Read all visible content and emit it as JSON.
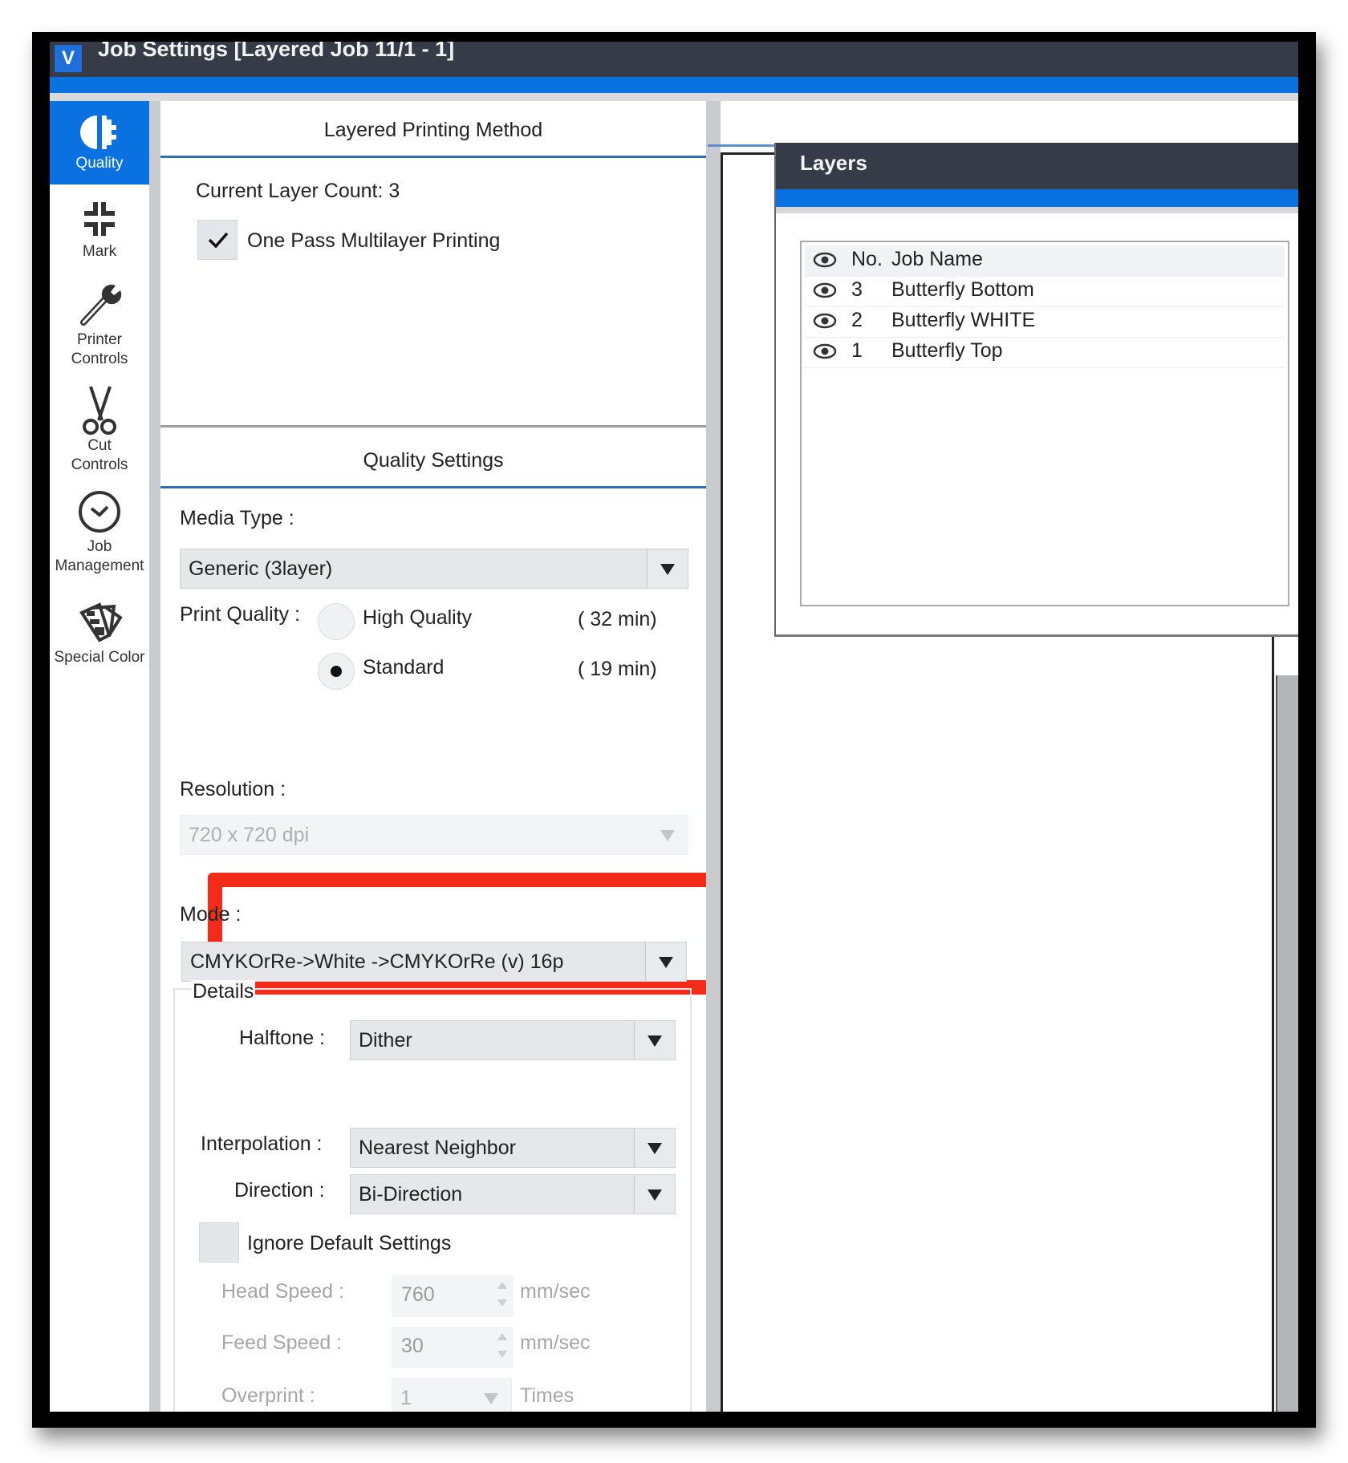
{
  "window": {
    "title": "Job Settings [Layered Job 11/1 - 1]",
    "logo": "V"
  },
  "sidebar": {
    "items": [
      {
        "label": "Quality",
        "icon": "quality-icon",
        "active": true
      },
      {
        "label": "Mark",
        "icon": "crop-marks-icon",
        "active": false
      },
      {
        "label": "Printer Controls",
        "icon": "wrench-icon",
        "active": false
      },
      {
        "label": "Cut Controls",
        "icon": "scissors-icon",
        "active": false
      },
      {
        "label": "Job Management",
        "icon": "clock-icon",
        "active": false
      },
      {
        "label": "Special Color",
        "icon": "swatch-fan-icon",
        "active": false
      }
    ]
  },
  "layered_method": {
    "heading": "Layered Printing Method",
    "layer_count_label": "Current Layer Count: 3",
    "one_pass_label": "One Pass Multilayer Printing",
    "one_pass_checked": true
  },
  "quality": {
    "heading": "Quality Settings",
    "media_type_label": "Media Type :",
    "media_type_value": "Generic (3layer)",
    "print_quality_label": "Print Quality :",
    "options": [
      {
        "label": "High Quality",
        "time": "( 32 min)",
        "selected": false
      },
      {
        "label": "Standard",
        "time": "( 19 min)",
        "selected": true
      }
    ],
    "resolution_label": "Resolution :",
    "resolution_value": "720 x 720 dpi",
    "mode_label": "Mode :",
    "mode_value": "CMYKOrRe->White ->CMYKOrRe (v) 16p",
    "highlight_color": "#f32b18"
  },
  "details": {
    "legend": "Details",
    "halftone_label": "Halftone :",
    "halftone_value": "Dither",
    "interpolation_label": "Interpolation :",
    "interpolation_value": "Nearest Neighbor",
    "direction_label": "Direction :",
    "direction_value": "Bi-Direction",
    "ignore_defaults_label": "Ignore Default Settings",
    "ignore_defaults_checked": false,
    "head_speed_label": "Head Speed :",
    "head_speed_value": "760",
    "head_speed_unit": "mm/sec",
    "feed_speed_label": "Feed Speed :",
    "feed_speed_value": "30",
    "feed_speed_unit": "mm/sec",
    "overprint_label": "Overprint :",
    "overprint_value": "1",
    "overprint_unit": "Times"
  },
  "layers": {
    "title": "Layers",
    "columns": {
      "no": "No.",
      "name": "Job Name"
    },
    "rows": [
      {
        "no": "3",
        "name": "Butterfly Bottom"
      },
      {
        "no": "2",
        "name": "Butterfly WHITE"
      },
      {
        "no": "1",
        "name": "Butterfly Top"
      }
    ]
  },
  "colors": {
    "accent_blue": "#0a72e0",
    "titlebar": "#363c47"
  }
}
